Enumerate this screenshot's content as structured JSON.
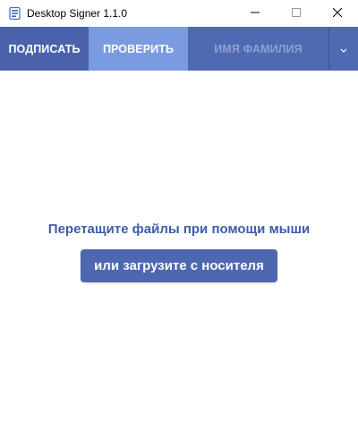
{
  "window": {
    "title": "Desktop Signer 1.1.0",
    "icon": "document-signer-icon",
    "controls": [
      "minimize-icon",
      "maximize-icon",
      "close-icon"
    ]
  },
  "tabs": [
    {
      "label": "ПОДПИСАТЬ",
      "active": false
    },
    {
      "label": "ПРОВЕРИТЬ",
      "active": true
    },
    {
      "label": "ИМЯ ФАМИЛИЯ",
      "active": false,
      "disabled": true
    }
  ],
  "tab_menu_icon": "chevron-down-icon",
  "main": {
    "drop_text": "Перетащите файлы при помощи мыши",
    "upload_button": "или загрузите с носителя"
  },
  "colors": {
    "tabbar": "#4f6ab3",
    "active_tab": "#7b9be0",
    "accent_text": "#3d5ba9",
    "button": "#4e67b1"
  }
}
